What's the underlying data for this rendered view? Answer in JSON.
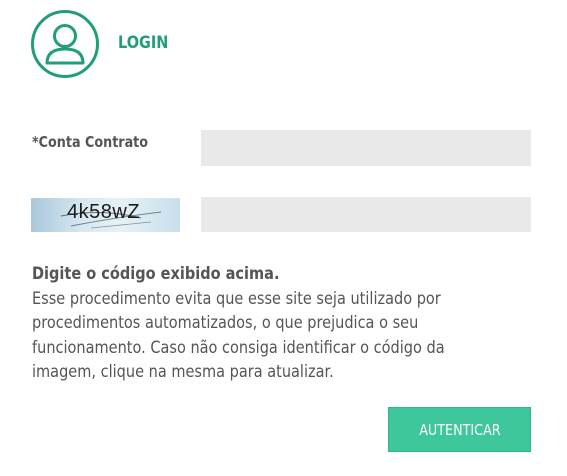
{
  "header": {
    "avatar_icon": "user-icon",
    "title": "LOGIN",
    "accent_color": "#1f9e79"
  },
  "form": {
    "contract_label": "*Conta Contrato",
    "contract_value": "",
    "captcha_image_text": "4k58wZ",
    "captcha_value": ""
  },
  "help": {
    "title": "Digite o código exibido acima.",
    "body": "Esse procedimento evita que esse site seja utilizado por procedimentos automatizados, o que prejudica o seu funcionamento. Caso não consiga identificar o código da imagem, clique na mesma para atualizar."
  },
  "actions": {
    "submit_label": "AUTENTICAR",
    "button_color": "#3ec69c"
  }
}
